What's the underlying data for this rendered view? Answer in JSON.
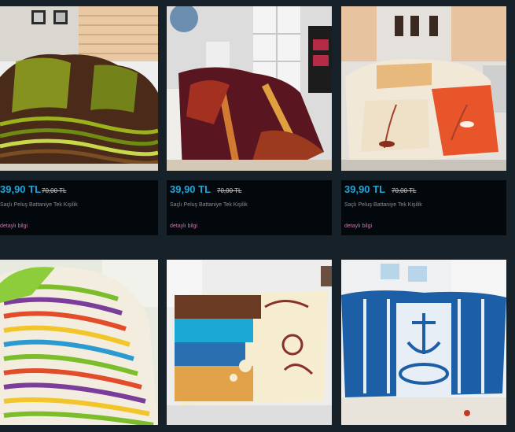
{
  "products": [
    {
      "price": "39,90 TL",
      "old_price": "70,00 TL",
      "name": "Saçlı Peluş Battaniye Tek Kişilik",
      "detail_label": "detaylı bilgi"
    },
    {
      "price": "39,90 TL",
      "old_price": "70,00 TL",
      "name": "Saçlı Peluş Battaniye Tek Kişilik",
      "detail_label": "detaylı bilgi"
    },
    {
      "price": "39,90 TL",
      "old_price": "70,00 TL",
      "name": "Saçlı Peluş Battaniye Tek Kişilik",
      "detail_label": "detaylı bilgi"
    }
  ],
  "colors": {
    "background": "#16212a",
    "info_panel": "#03080c",
    "price": "#1fa6d8",
    "detail_link": "#c27aa8"
  }
}
